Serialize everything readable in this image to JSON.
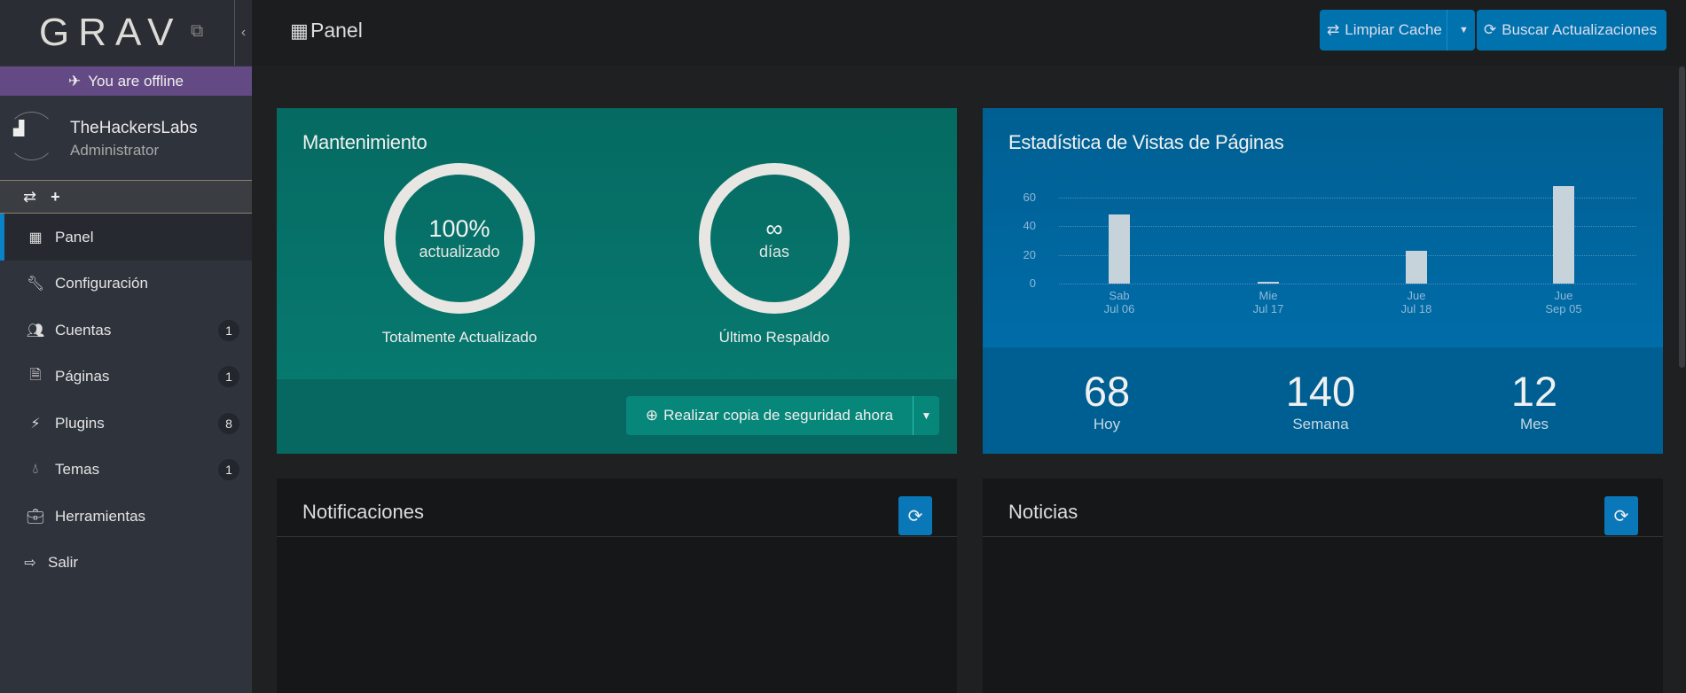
{
  "sidebar": {
    "logo": "GRAV",
    "offline": "You are offline",
    "user": {
      "name": "TheHackersLabs",
      "role": "Administrator"
    },
    "items": [
      {
        "label": "Panel",
        "icon": "grid-icon",
        "active": true
      },
      {
        "label": "Configuración",
        "icon": "wrench-icon"
      },
      {
        "label": "Cuentas",
        "icon": "users-icon",
        "badge": "1"
      },
      {
        "label": "Páginas",
        "icon": "file-icon",
        "badge": "1"
      },
      {
        "label": "Plugins",
        "icon": "plug-icon",
        "badge": "8"
      },
      {
        "label": "Temas",
        "icon": "drop-icon",
        "badge": "1"
      },
      {
        "label": "Herramientas",
        "icon": "briefcase-icon"
      },
      {
        "label": "Salir",
        "icon": "sign-out-icon"
      }
    ]
  },
  "header": {
    "title": "Panel",
    "clear_cache": "Limpiar Cache",
    "check_updates": "Buscar Actualizaciones"
  },
  "maintenance": {
    "title": "Mantenimiento",
    "updated_value": "100%",
    "updated_unit": "actualizado",
    "updated_label": "Totalmente Actualizado",
    "backup_value": "∞",
    "backup_unit": "días",
    "backup_label": "Último Respaldo",
    "backup_button": "Realizar copia de seguridad ahora"
  },
  "stats": {
    "title": "Estadística de Vistas de Páginas",
    "today": "68",
    "today_label": "Hoy",
    "week": "140",
    "week_label": "Semana",
    "month": "12",
    "month_label": "Mes"
  },
  "chart_data": {
    "type": "bar",
    "categories": [
      [
        "Sab",
        "Jul 06"
      ],
      [
        "Mie",
        "Jul 17"
      ],
      [
        "Jue",
        "Jul 18"
      ],
      [
        "Jue",
        "Sep 05"
      ]
    ],
    "values": [
      48,
      1,
      23,
      68
    ],
    "yticks": [
      "0",
      "20",
      "40",
      "60"
    ],
    "ylim": [
      0,
      60
    ],
    "grid": true,
    "colors": {
      "bar": "#c6d3da",
      "background": "#0066a0"
    }
  },
  "notifications": {
    "title": "Notificaciones"
  },
  "news": {
    "title": "Noticias"
  },
  "colors": {
    "accent": "#0073ae",
    "maintenance": "#077a6f",
    "offline": "#634a84"
  }
}
